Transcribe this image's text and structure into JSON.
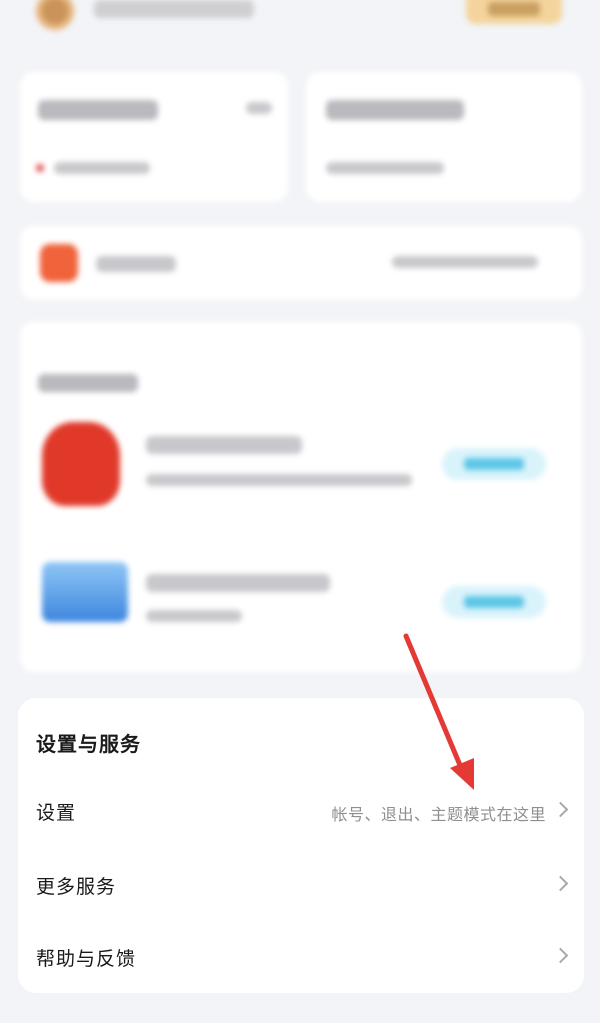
{
  "settings_services": {
    "title": "设置与服务",
    "items": [
      {
        "label": "设置",
        "hint": "帐号、退出、主题模式在这里"
      },
      {
        "label": "更多服务",
        "hint": ""
      },
      {
        "label": "帮助与反馈",
        "hint": ""
      }
    ]
  },
  "colors": {
    "annotation_arrow": "#e53935",
    "background": "#f3f4f7"
  },
  "icons": {
    "chevron": "chevron-right-icon"
  }
}
